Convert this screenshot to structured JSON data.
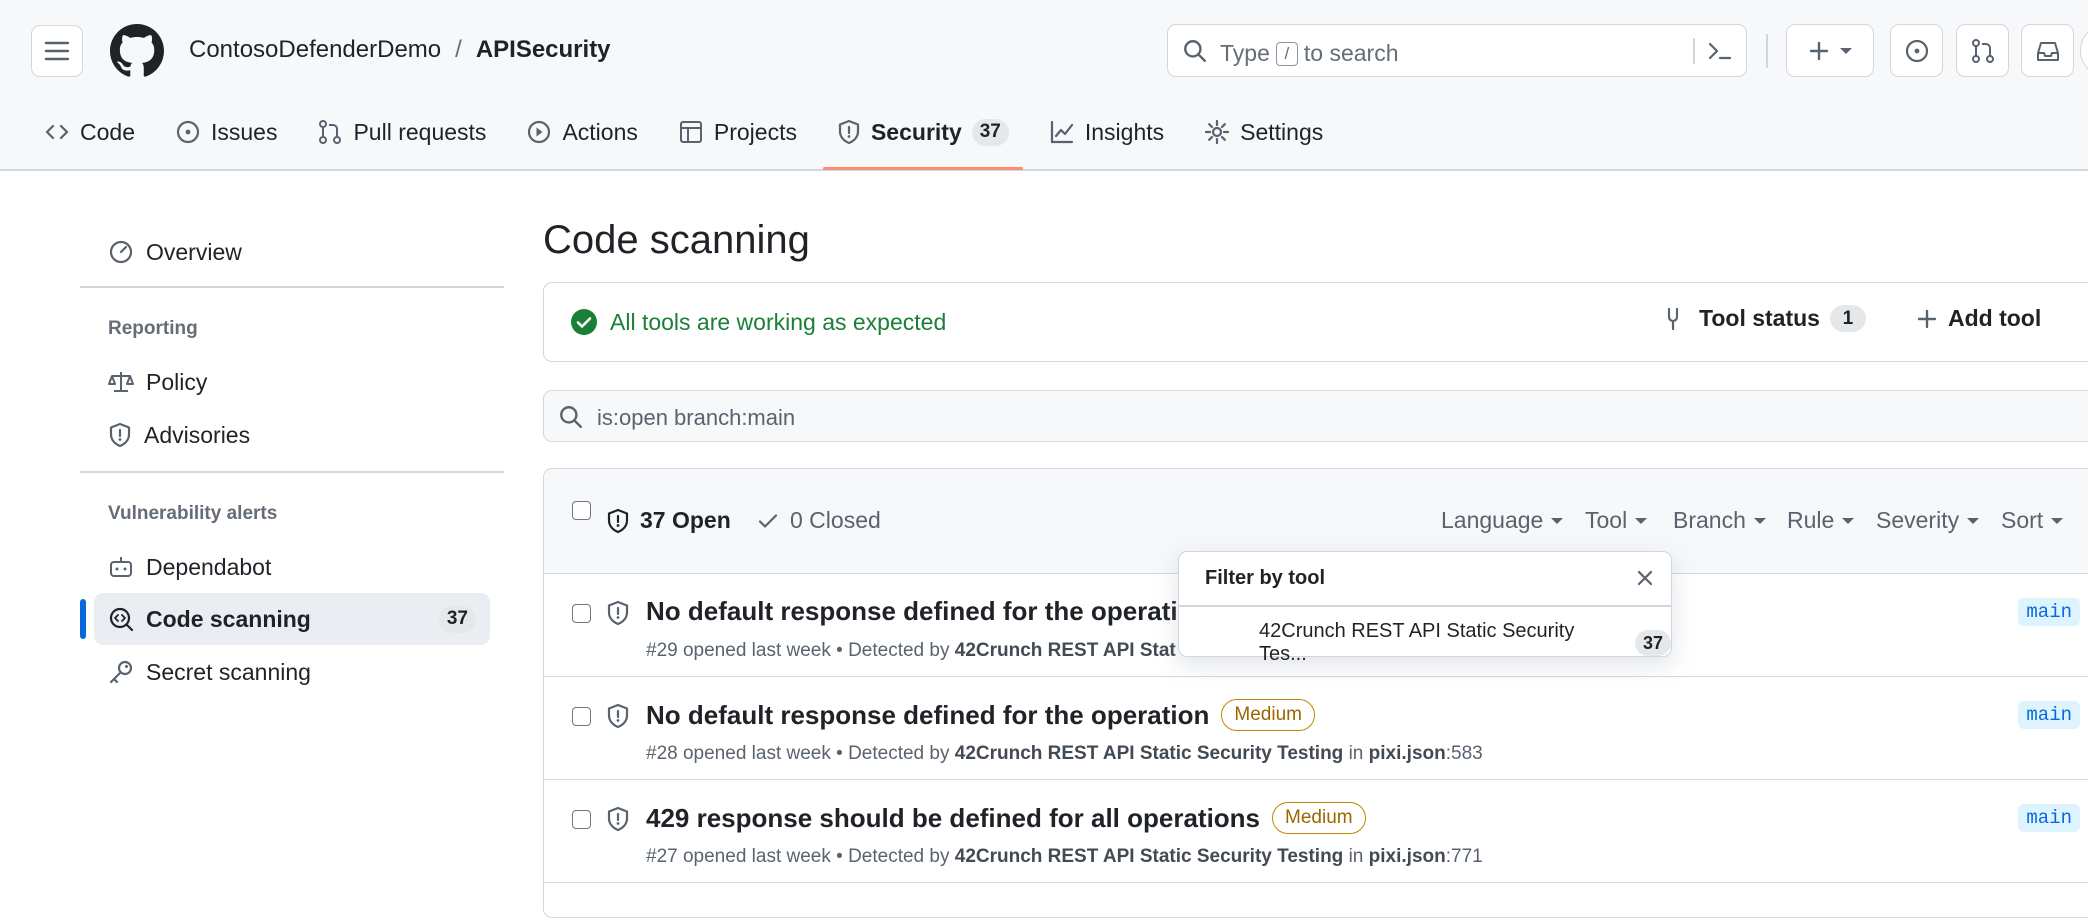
{
  "header": {
    "owner": "ContosoDefenderDemo",
    "separator": "/",
    "repo": "APISecurity",
    "search": {
      "prefix": "Type",
      "key": "/",
      "suffix": "to search"
    }
  },
  "nav_tabs": [
    {
      "label": "Code",
      "icon": "code-icon"
    },
    {
      "label": "Issues",
      "icon": "issue-opened-icon"
    },
    {
      "label": "Pull requests",
      "icon": "git-pull-request-icon"
    },
    {
      "label": "Actions",
      "icon": "play-icon"
    },
    {
      "label": "Projects",
      "icon": "table-icon"
    },
    {
      "label": "Security",
      "icon": "shield-icon",
      "count": "37",
      "active": true
    },
    {
      "label": "Insights",
      "icon": "graph-icon"
    },
    {
      "label": "Settings",
      "icon": "gear-icon"
    }
  ],
  "sidebar": {
    "overview": "Overview",
    "reporting_heading": "Reporting",
    "policy": "Policy",
    "advisories": "Advisories",
    "vuln_heading": "Vulnerability alerts",
    "dependabot": "Dependabot",
    "code_scanning": "Code scanning",
    "code_scanning_count": "37",
    "secret_scanning": "Secret scanning"
  },
  "main": {
    "title": "Code scanning",
    "status_message": "All tools are working as expected",
    "tool_status_label": "Tool status",
    "tool_status_count": "1",
    "add_tool_label": "Add tool",
    "filter_query": "is:open branch:main"
  },
  "list": {
    "open_label": "37 Open",
    "closed_label": "0 Closed",
    "filters": [
      "Language",
      "Tool",
      "Branch",
      "Rule",
      "Severity",
      "Sort"
    ],
    "rows": [
      {
        "title": "No default response defined for the operatio",
        "severity": "",
        "meta_prefix": "#29 opened last week • Detected by ",
        "tool": "42Crunch REST API Stat",
        "in": "",
        "file": "",
        "line": "",
        "branch": "main"
      },
      {
        "title": "No default response defined for the operation",
        "severity": "Medium",
        "meta_prefix": "#28 opened last week • Detected by ",
        "tool": "42Crunch REST API Static Security Testing",
        "in": " in ",
        "file": "pixi.json",
        "line": ":583",
        "branch": "main"
      },
      {
        "title": "429 response should be defined for all operations",
        "severity": "Medium",
        "meta_prefix": "#27 opened last week • Detected by ",
        "tool": "42Crunch REST API Static Security Testing",
        "in": " in ",
        "file": "pixi.json",
        "line": ":771",
        "branch": "main"
      }
    ]
  },
  "popover": {
    "title": "Filter by tool",
    "option_label": "42Crunch REST API Static Security Tes...",
    "option_count": "37"
  },
  "colors": {
    "accent_blue": "#0969da",
    "success_green": "#1a7f37",
    "tab_underline": "#fd8c73",
    "medium_badge": "#9a6700"
  }
}
